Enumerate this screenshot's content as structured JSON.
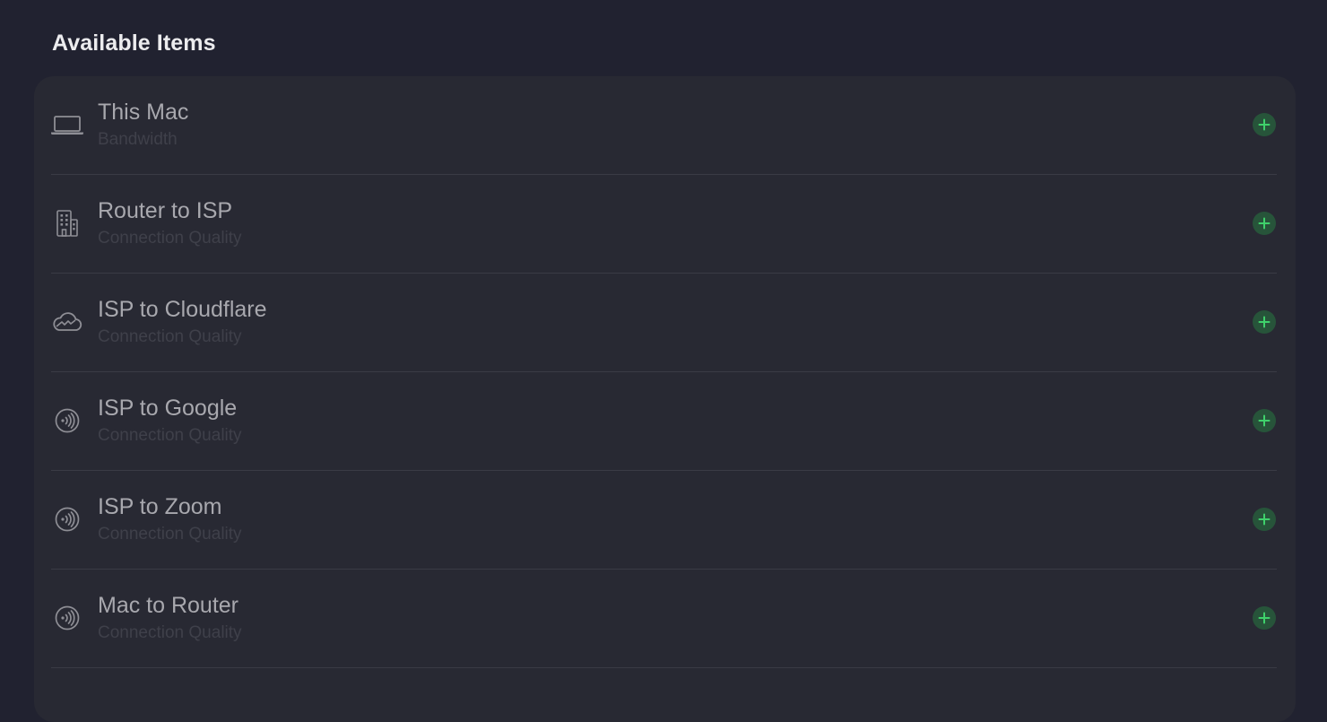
{
  "section": {
    "title": "Available Items"
  },
  "colors": {
    "background": "#212230",
    "panel": "#282933",
    "add_button_bg": "#27543a",
    "add_button_plus": "#3fd16b"
  },
  "items": [
    {
      "title": "This Mac",
      "subtitle": "Bandwidth",
      "icon": "laptop-icon"
    },
    {
      "title": "Router to ISP",
      "subtitle": "Connection Quality",
      "icon": "building-icon"
    },
    {
      "title": "ISP to Cloudflare",
      "subtitle": "Connection Quality",
      "icon": "cloud-icon"
    },
    {
      "title": "ISP to Google",
      "subtitle": "Connection Quality",
      "icon": "signal-icon"
    },
    {
      "title": "ISP to Zoom",
      "subtitle": "Connection Quality",
      "icon": "signal-icon"
    },
    {
      "title": "Mac to Router",
      "subtitle": "Connection Quality",
      "icon": "signal-icon"
    }
  ]
}
